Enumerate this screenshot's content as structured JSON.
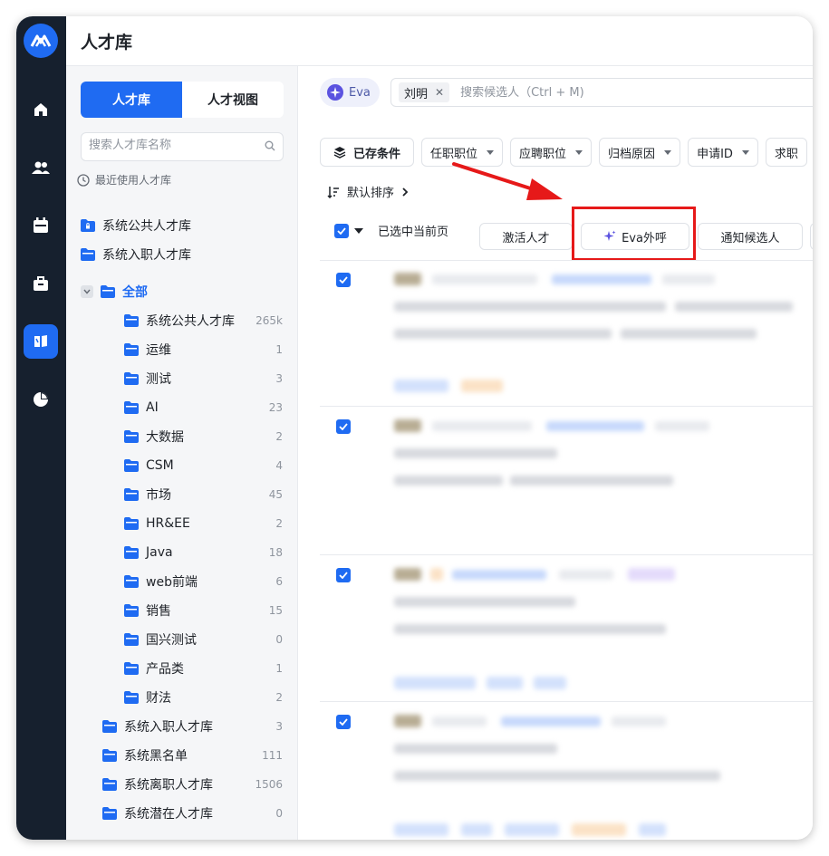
{
  "app": {
    "title": "人才库"
  },
  "rail": {
    "items": [
      {
        "icon": "home-icon",
        "active": false
      },
      {
        "icon": "users-icon",
        "active": false
      },
      {
        "icon": "calendar-icon",
        "active": false
      },
      {
        "icon": "briefcase-icon",
        "active": false
      },
      {
        "icon": "talent-library-icon",
        "active": true
      },
      {
        "icon": "pie-chart-icon",
        "active": false
      }
    ]
  },
  "library": {
    "tabs": [
      "人才库",
      "人才视图"
    ],
    "search_placeholder": "搜索人才库名称",
    "recent_label": "最近使用人才库",
    "recent_items": [
      "系统公共人才库",
      "系统入职人才库"
    ],
    "all_label": "全部",
    "children": [
      {
        "label": "系统公共人才库",
        "count": "265k"
      },
      {
        "label": "运维",
        "count": "1"
      },
      {
        "label": "测试",
        "count": "3"
      },
      {
        "label": "AI",
        "count": "23"
      },
      {
        "label": "大数据",
        "count": "2"
      },
      {
        "label": "CSM",
        "count": "4"
      },
      {
        "label": "市场",
        "count": "45"
      },
      {
        "label": "HR&EE",
        "count": "2"
      },
      {
        "label": "Java",
        "count": "18"
      },
      {
        "label": "web前端",
        "count": "6"
      },
      {
        "label": "销售",
        "count": "15"
      },
      {
        "label": "国兴测试",
        "count": "0"
      },
      {
        "label": "产品类",
        "count": "1"
      },
      {
        "label": "财法",
        "count": "2"
      }
    ],
    "system_libs": [
      {
        "label": "系统入职人才库",
        "count": "3"
      },
      {
        "label": "系统黑名单",
        "count": "111"
      },
      {
        "label": "系统离职人才库",
        "count": "1506"
      },
      {
        "label": "系统潜在人才库",
        "count": "0"
      }
    ]
  },
  "main": {
    "eva_label": "Eva",
    "search_chip": "刘明",
    "search_placeholder": "搜索候选人（Ctrl + M)",
    "saved_filters": "已存条件",
    "filters": [
      "任职职位",
      "应聘职位",
      "归档原因",
      "申请ID",
      "求职"
    ],
    "sort_label": "默认排序",
    "select_current_page": "已选中当前页",
    "bulk_actions": {
      "activate": "激活人才",
      "eva_call": "Eva外呼",
      "notify": "通知候选人"
    }
  },
  "colors": {
    "accent": "#1f6bf2",
    "rail": "#16202e",
    "highlight": "#e61919"
  }
}
